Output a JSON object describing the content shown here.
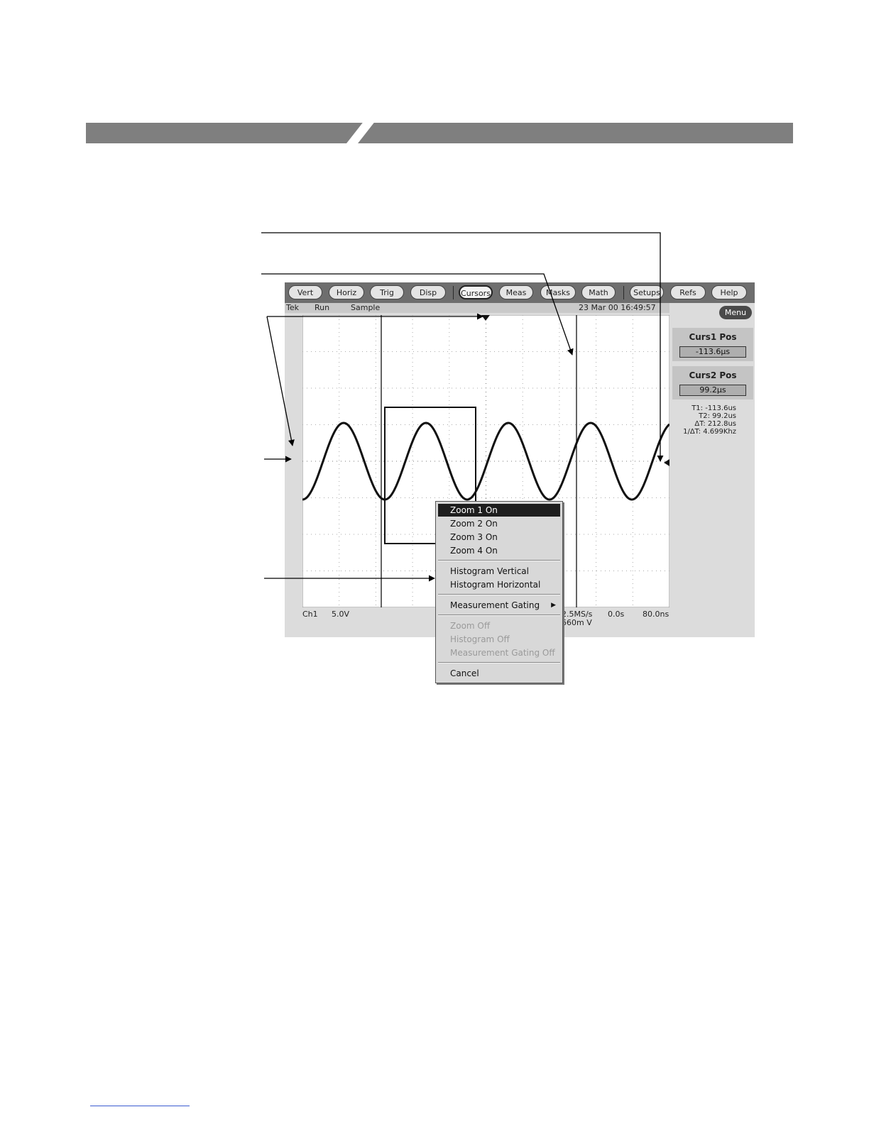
{
  "toolbar": {
    "buttons": [
      "Vert",
      "Horiz",
      "Trig",
      "Disp",
      "Cursors",
      "Meas",
      "Masks",
      "Math",
      "Setups",
      "Refs",
      "Help"
    ],
    "active": "Cursors"
  },
  "status": {
    "brand": "Tek",
    "mode": "Run",
    "acquisition": "Sample",
    "datetime": "23 Mar 00 16:49:57"
  },
  "menu_label": "Menu",
  "cursor_panels": {
    "curs1": {
      "title": "Curs1 Pos",
      "value": "-113.6µs"
    },
    "curs2": {
      "title": "Curs2 Pos",
      "value": "99.2µs"
    }
  },
  "readouts": {
    "t1": "T1: -113.6us",
    "t2": "T2:  99.2us",
    "dt": "ΔT:  212.8us",
    "inv_dt": "1/ΔT: 4.699Khz"
  },
  "bottom": {
    "channel": "Ch1",
    "scale": "5.0V",
    "rate": "2.5MS/s",
    "position": "0.0s",
    "record": "80.0ns",
    "level": "660m  V"
  },
  "ground_marker": "1",
  "context_menu": {
    "items": [
      {
        "label": "Zoom 1 On",
        "state": "selected"
      },
      {
        "label": "Zoom 2 On",
        "state": "normal"
      },
      {
        "label": "Zoom 3 On",
        "state": "normal"
      },
      {
        "label": "Zoom 4 On",
        "state": "normal"
      },
      {
        "label": "Histogram Vertical",
        "state": "normal"
      },
      {
        "label": "Histogram Horizontal",
        "state": "normal"
      },
      {
        "label": "Measurement Gating",
        "state": "submenu"
      },
      {
        "label": "Zoom Off",
        "state": "disabled"
      },
      {
        "label": "Histogram Off",
        "state": "disabled"
      },
      {
        "label": "Measurement Gating Off",
        "state": "disabled"
      },
      {
        "label": "Cancel",
        "state": "normal"
      }
    ]
  },
  "colors": {
    "header_bar": "#7f7f7f",
    "toolbar": "#6e6e6e",
    "screen_bg": "#dcdcdc",
    "waveform": "#111111",
    "menu_selected": "#1e1e1e"
  }
}
